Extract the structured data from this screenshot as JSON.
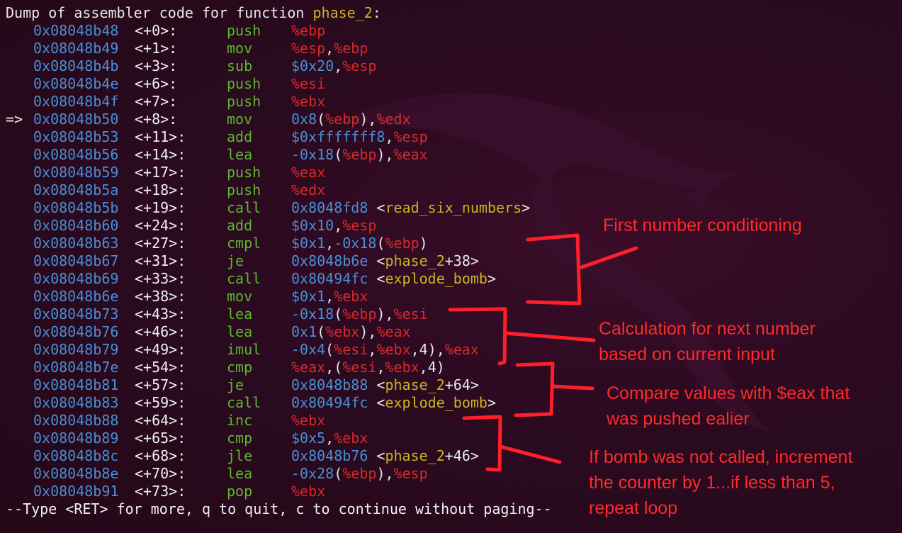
{
  "header": {
    "prefix": "Dump of assembler code for function ",
    "function": "phase_2",
    "suffix": ":"
  },
  "current_marker": "=>",
  "instructions": [
    {
      "addr": "0x08048b48",
      "off": "<+0>:",
      "mnem": "push",
      "ops": [
        [
          "%ebp",
          "reg"
        ]
      ]
    },
    {
      "addr": "0x08048b49",
      "off": "<+1>:",
      "mnem": "mov",
      "ops": [
        [
          "%esp",
          "reg"
        ],
        [
          ",",
          "txt"
        ],
        [
          "%ebp",
          "reg"
        ]
      ]
    },
    {
      "addr": "0x08048b4b",
      "off": "<+3>:",
      "mnem": "sub",
      "ops": [
        [
          "$0x20",
          "imm"
        ],
        [
          ",",
          "txt"
        ],
        [
          "%esp",
          "reg"
        ]
      ]
    },
    {
      "addr": "0x08048b4e",
      "off": "<+6>:",
      "mnem": "push",
      "ops": [
        [
          "%esi",
          "reg"
        ]
      ]
    },
    {
      "addr": "0x08048b4f",
      "off": "<+7>:",
      "mnem": "push",
      "ops": [
        [
          "%ebx",
          "reg"
        ]
      ]
    },
    {
      "addr": "0x08048b50",
      "off": "<+8>:",
      "mnem": "mov",
      "current": true,
      "ops": [
        [
          "0x8",
          "imm"
        ],
        [
          "(",
          "txt"
        ],
        [
          "%ebp",
          "reg"
        ],
        [
          "),",
          "txt"
        ],
        [
          "%edx",
          "reg"
        ]
      ]
    },
    {
      "addr": "0x08048b53",
      "off": "<+11>:",
      "mnem": "add",
      "ops": [
        [
          "$0xfffffff8",
          "imm"
        ],
        [
          ",",
          "txt"
        ],
        [
          "%esp",
          "reg"
        ]
      ]
    },
    {
      "addr": "0x08048b56",
      "off": "<+14>:",
      "mnem": "lea",
      "ops": [
        [
          "-0x18",
          "imm"
        ],
        [
          "(",
          "txt"
        ],
        [
          "%ebp",
          "reg"
        ],
        [
          "),",
          "txt"
        ],
        [
          "%eax",
          "reg"
        ]
      ]
    },
    {
      "addr": "0x08048b59",
      "off": "<+17>:",
      "mnem": "push",
      "ops": [
        [
          "%eax",
          "reg"
        ]
      ]
    },
    {
      "addr": "0x08048b5a",
      "off": "<+18>:",
      "mnem": "push",
      "ops": [
        [
          "%edx",
          "reg"
        ]
      ]
    },
    {
      "addr": "0x08048b5b",
      "off": "<+19>:",
      "mnem": "call",
      "ops": [
        [
          "0x8048fd8",
          "imm"
        ],
        [
          " <",
          "txt"
        ],
        [
          "read_six_numbers",
          "sym"
        ],
        [
          ">",
          "txt"
        ]
      ]
    },
    {
      "addr": "0x08048b60",
      "off": "<+24>:",
      "mnem": "add",
      "ops": [
        [
          "$0x10",
          "imm"
        ],
        [
          ",",
          "txt"
        ],
        [
          "%esp",
          "reg"
        ]
      ]
    },
    {
      "addr": "0x08048b63",
      "off": "<+27>:",
      "mnem": "cmpl",
      "ops": [
        [
          "$0x1",
          "imm"
        ],
        [
          ",",
          "txt"
        ],
        [
          "-0x18",
          "imm"
        ],
        [
          "(",
          "txt"
        ],
        [
          "%ebp",
          "reg"
        ],
        [
          ")",
          "txt"
        ]
      ]
    },
    {
      "addr": "0x08048b67",
      "off": "<+31>:",
      "mnem": "je",
      "ops": [
        [
          "0x8048b6e",
          "imm"
        ],
        [
          " <",
          "txt"
        ],
        [
          "phase_2",
          "sym"
        ],
        [
          "+38>",
          "txt"
        ]
      ]
    },
    {
      "addr": "0x08048b69",
      "off": "<+33>:",
      "mnem": "call",
      "ops": [
        [
          "0x80494fc",
          "imm"
        ],
        [
          " <",
          "txt"
        ],
        [
          "explode_bomb",
          "sym"
        ],
        [
          ">",
          "txt"
        ]
      ]
    },
    {
      "addr": "0x08048b6e",
      "off": "<+38>:",
      "mnem": "mov",
      "ops": [
        [
          "$0x1",
          "imm"
        ],
        [
          ",",
          "txt"
        ],
        [
          "%ebx",
          "reg"
        ]
      ]
    },
    {
      "addr": "0x08048b73",
      "off": "<+43>:",
      "mnem": "lea",
      "ops": [
        [
          "-0x18",
          "imm"
        ],
        [
          "(",
          "txt"
        ],
        [
          "%ebp",
          "reg"
        ],
        [
          "),",
          "txt"
        ],
        [
          "%esi",
          "reg"
        ]
      ]
    },
    {
      "addr": "0x08048b76",
      "off": "<+46>:",
      "mnem": "lea",
      "ops": [
        [
          "0x1",
          "imm"
        ],
        [
          "(",
          "txt"
        ],
        [
          "%ebx",
          "reg"
        ],
        [
          "),",
          "txt"
        ],
        [
          "%eax",
          "reg"
        ]
      ]
    },
    {
      "addr": "0x08048b79",
      "off": "<+49>:",
      "mnem": "imul",
      "ops": [
        [
          "-0x4",
          "imm"
        ],
        [
          "(",
          "txt"
        ],
        [
          "%esi",
          "reg"
        ],
        [
          ",",
          "txt"
        ],
        [
          "%ebx",
          "reg"
        ],
        [
          ",4),",
          "txt"
        ],
        [
          "%eax",
          "reg"
        ]
      ]
    },
    {
      "addr": "0x08048b7e",
      "off": "<+54>:",
      "mnem": "cmp",
      "ops": [
        [
          "%eax",
          "reg"
        ],
        [
          ",(",
          "txt"
        ],
        [
          "%esi",
          "reg"
        ],
        [
          ",",
          "txt"
        ],
        [
          "%ebx",
          "reg"
        ],
        [
          ",4)",
          "txt"
        ]
      ]
    },
    {
      "addr": "0x08048b81",
      "off": "<+57>:",
      "mnem": "je",
      "ops": [
        [
          "0x8048b88",
          "imm"
        ],
        [
          " <",
          "txt"
        ],
        [
          "phase_2",
          "sym"
        ],
        [
          "+64>",
          "txt"
        ]
      ]
    },
    {
      "addr": "0x08048b83",
      "off": "<+59>:",
      "mnem": "call",
      "ops": [
        [
          "0x80494fc",
          "imm"
        ],
        [
          " <",
          "txt"
        ],
        [
          "explode_bomb",
          "sym"
        ],
        [
          ">",
          "txt"
        ]
      ]
    },
    {
      "addr": "0x08048b88",
      "off": "<+64>:",
      "mnem": "inc",
      "ops": [
        [
          "%ebx",
          "reg"
        ]
      ]
    },
    {
      "addr": "0x08048b89",
      "off": "<+65>:",
      "mnem": "cmp",
      "ops": [
        [
          "$0x5",
          "imm"
        ],
        [
          ",",
          "txt"
        ],
        [
          "%ebx",
          "reg"
        ]
      ]
    },
    {
      "addr": "0x08048b8c",
      "off": "<+68>:",
      "mnem": "jle",
      "ops": [
        [
          "0x8048b76",
          "imm"
        ],
        [
          " <",
          "txt"
        ],
        [
          "phase_2",
          "sym"
        ],
        [
          "+46>",
          "txt"
        ]
      ]
    },
    {
      "addr": "0x08048b8e",
      "off": "<+70>:",
      "mnem": "lea",
      "ops": [
        [
          "-0x28",
          "imm"
        ],
        [
          "(",
          "txt"
        ],
        [
          "%ebp",
          "reg"
        ],
        [
          "),",
          "txt"
        ],
        [
          "%esp",
          "reg"
        ]
      ]
    },
    {
      "addr": "0x08048b91",
      "off": "<+73>:",
      "mnem": "pop",
      "ops": [
        [
          "%ebx",
          "reg"
        ]
      ]
    }
  ],
  "footer": "--Type <RET> for more, q to quit, c to continue without paging--",
  "annotations": [
    {
      "lines": [
        "First number conditioning"
      ]
    },
    {
      "lines": [
        "Calculation for next number",
        "based on  current input"
      ]
    },
    {
      "lines": [
        "Compare values with $eax that",
        "was pushed ealier"
      ]
    },
    {
      "lines": [
        "If bomb was not called, increment",
        "the counter by 1...if less than 5,",
        "repeat loop"
      ]
    }
  ],
  "colors": {
    "background": "#2b0a20",
    "address": "#4a8fd6",
    "mnemonic": "#5cb82e",
    "register": "#d82a2a",
    "symbol": "#cbb423",
    "annotation": "#ff2a2a"
  },
  "icons": {
    "watermark": "kali-dragon-icon"
  }
}
